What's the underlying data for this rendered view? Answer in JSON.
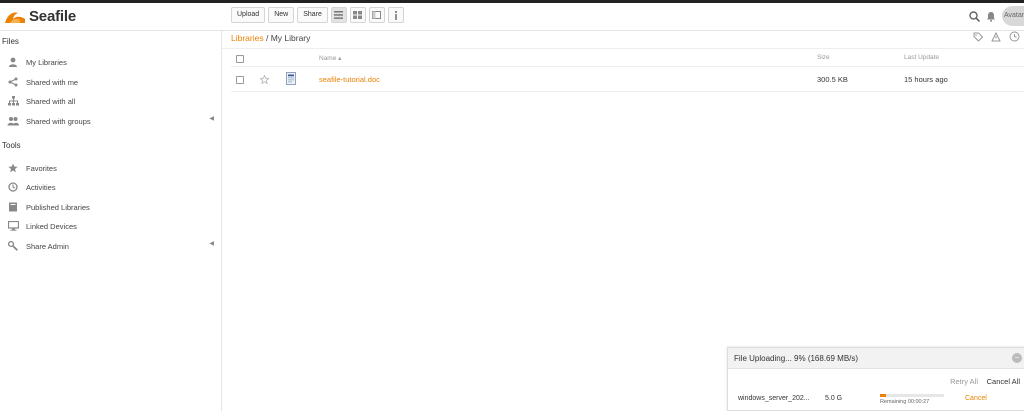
{
  "brand": {
    "name": "Seafile",
    "accent": "#eb8205"
  },
  "toolbar": {
    "upload_label": "Upload",
    "new_label": "New",
    "share_label": "Share",
    "view_icons": [
      "list-view-icon",
      "grid-view-icon",
      "map-view-icon",
      "info-icon"
    ]
  },
  "header": {
    "avatar_label": "Avatar"
  },
  "sidebar": {
    "files_title": "Files",
    "files_items": [
      {
        "label": "My Libraries",
        "icon": "user-icon"
      },
      {
        "label": "Shared with me",
        "icon": "share-icon"
      },
      {
        "label": "Shared with all",
        "icon": "org-icon"
      },
      {
        "label": "Shared with groups",
        "icon": "group-icon"
      }
    ],
    "tools_title": "Tools",
    "tools_items": [
      {
        "label": "Favorites",
        "icon": "star-icon"
      },
      {
        "label": "Activities",
        "icon": "clock-icon"
      },
      {
        "label": "Published Libraries",
        "icon": "book-icon"
      },
      {
        "label": "Linked Devices",
        "icon": "monitor-icon"
      },
      {
        "label": "Share Admin",
        "icon": "wrench-icon"
      }
    ]
  },
  "breadcrumb": {
    "root": "Libraries",
    "separator": " / ",
    "current": "My Library"
  },
  "table": {
    "headers": {
      "name": "Name ▴",
      "size": "Size",
      "last_update": "Last Update"
    },
    "rows": [
      {
        "name": "seafile-tutorial.doc",
        "size": "300.5 KB",
        "last_update": "15 hours ago",
        "icon": "document-icon"
      }
    ]
  },
  "upload": {
    "title": "File Uploading... 9% (168.69 MB/s)",
    "retry_all": "Retry All",
    "cancel_all": "Cancel All",
    "file_name": "windows_server_202...",
    "file_size": "5.0 G",
    "progress_fraction": 0.09,
    "remaining": "Remaining 00:00:27",
    "cancel": "Cancel"
  }
}
